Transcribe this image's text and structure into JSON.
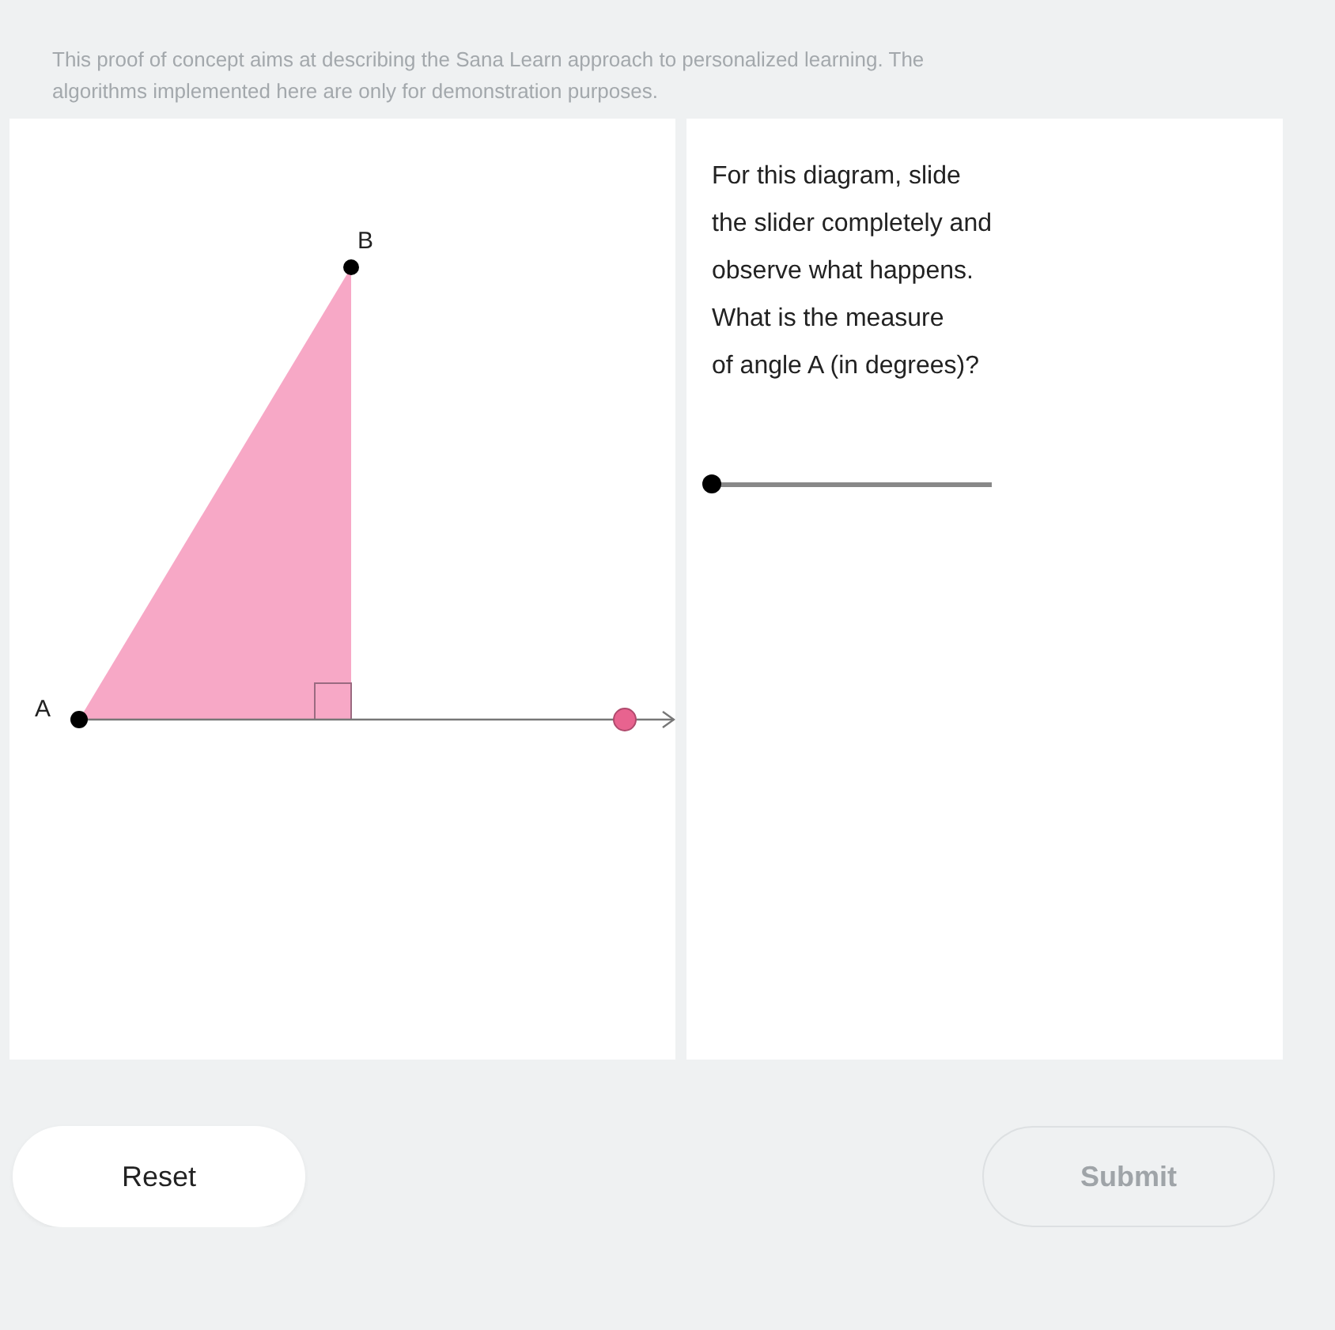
{
  "intro": "This proof of concept aims at describing the Sana Learn approach to personalized learning. The algorithms implemented here are only for demonstration purposes.",
  "diagram": {
    "points": [
      {
        "label": "A"
      },
      {
        "label": "B"
      }
    ]
  },
  "question": {
    "lines": [
      "For this diagram, slide",
      "the slider completely and",
      "observe what happens.",
      "What is the measure",
      "of angle A (in degrees)?"
    ]
  },
  "slider": {
    "level": 0
  },
  "buttons": [
    {
      "kind": "reset",
      "label": "Reset",
      "disabled": false
    },
    {
      "kind": "submit",
      "label": "Submit",
      "disabled": true
    }
  ]
}
